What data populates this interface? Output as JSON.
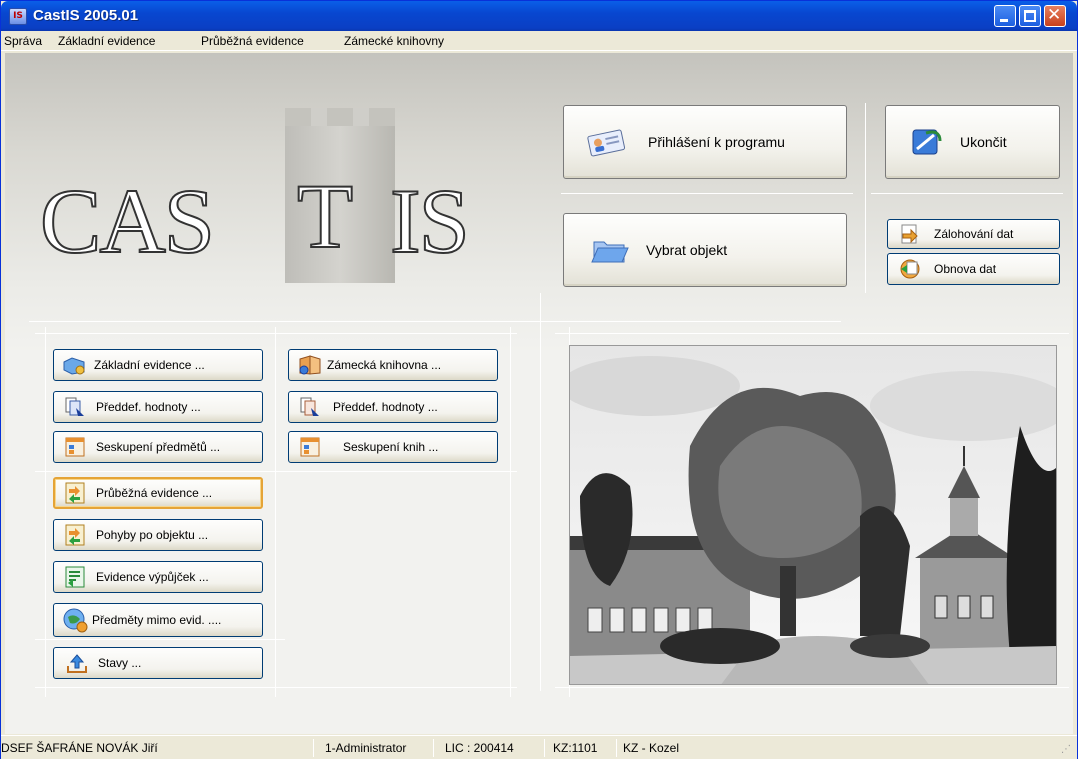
{
  "window": {
    "title": "CastIS 2005.01",
    "app_icon": "IS"
  },
  "menu": [
    "Správa",
    "Základní evidence",
    "Průběžná evidence",
    "Zámecké knihovny"
  ],
  "logo": {
    "left": "CAS",
    "mid": "T",
    "right": "IS"
  },
  "top_buttons": {
    "login": "Přihlášení k programu",
    "exit": "Ukončit",
    "select_object": "Vybrat objekt",
    "backup": "Zálohování dat",
    "restore": "Obnova dat"
  },
  "left_col": [
    "Základní evidence ...",
    "Předdef. hodnoty ...",
    "Seskupení předmětů ...",
    "Průběžná evidence ...",
    "Pohyby po objektu ...",
    "Evidence výpůjček ...",
    "Předměty mimo evid. ....",
    "Stavy ..."
  ],
  "mid_col": [
    "Zámecká knihovna ...",
    "Předdef. hodnoty ...",
    "Seskupení knih ..."
  ],
  "status": {
    "user": "DSEF ŠAFRÁNE NOVÁK Jiří",
    "role": "1-Administrator",
    "lic": "LIC : 200414",
    "kz": "KZ:1101",
    "kz_name": "KZ - Kozel"
  },
  "colors": {
    "titlebar": "#0a4fd8",
    "face": "#ece9d8",
    "active_border": "#e5a437"
  }
}
